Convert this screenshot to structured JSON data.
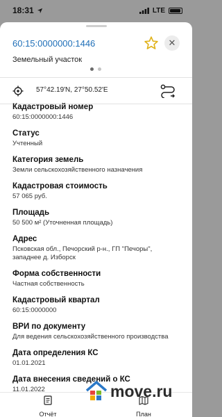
{
  "status_bar": {
    "time": "18:31",
    "carrier": "LTE"
  },
  "header": {
    "title": "60:15:0000000:1446",
    "subtitle": "Земельный участок",
    "favorite_icon": "star-icon",
    "close_icon": "close-icon",
    "pages": 2,
    "active_page": 1
  },
  "coords": {
    "text": "57°42.19'N, 27°50.52'E",
    "icon": "target-icon",
    "action_icon": "route-icon"
  },
  "fields": [
    {
      "label": "Кадастровый номер",
      "value": "60:15:0000000:1446"
    },
    {
      "label": "Статус",
      "value": "Учтенный"
    },
    {
      "label": "Категория земель",
      "value": "Земли сельскохозяйственного назначения"
    },
    {
      "label": "Кадастровая стоимость",
      "value": "57 065 руб."
    },
    {
      "label": "Площадь",
      "value": "50 500 м² (Уточненная площадь)"
    },
    {
      "label": "Адрес",
      "value": "Псковская обл., Печорский р-н., ГП \"Печоры\", западнее д. Изборск"
    },
    {
      "label": "Форма собственности",
      "value": "Частная собственность"
    },
    {
      "label": "Кадастровый квартал",
      "value": "60:15:0000000"
    },
    {
      "label": "ВРИ по документу",
      "value": "Для ведения сельскохозяйственного производства"
    },
    {
      "label": "Дата определения КС",
      "value": "01.01.2021"
    },
    {
      "label": "Дата внесения сведений о КС",
      "value": "11.01.2022"
    }
  ],
  "bottom_bar": {
    "report_label": "Отчёт",
    "plan_label": "План"
  },
  "watermark": {
    "text": "move.ru"
  }
}
